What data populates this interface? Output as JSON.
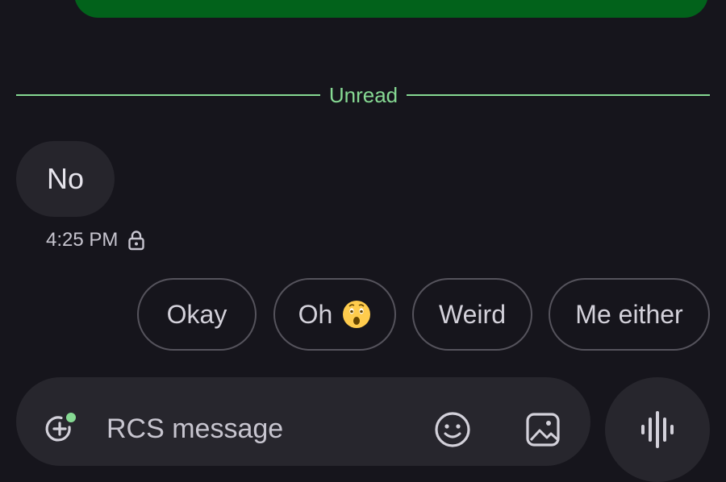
{
  "divider": {
    "label": "Unread"
  },
  "received_message": {
    "text": "No",
    "time": "4:25 PM",
    "status_icon": "lock-icon"
  },
  "smart_replies": [
    {
      "label": "Okay"
    },
    {
      "label": "Oh",
      "emoji": "astonished-face"
    },
    {
      "label": "Weird"
    },
    {
      "label": "Me either"
    }
  ],
  "composer": {
    "placeholder": "RCS message",
    "icons": [
      "add-content-icon",
      "emoji-icon",
      "gallery-icon",
      "voice-message-icon"
    ]
  },
  "colors": {
    "background": "#16151c",
    "sent_bubble": "#02621b",
    "unread_accent": "#86d993",
    "received_bubble": "#26252c",
    "chip_border": "#55535c"
  }
}
